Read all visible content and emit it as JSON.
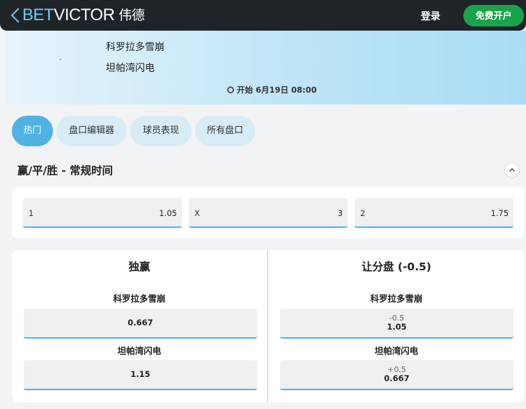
{
  "header": {
    "logo_bet": "BET",
    "logo_victor": "VICTOR",
    "logo_cn": "伟德",
    "login_label": "登录",
    "register_label": "免费开户"
  },
  "match": {
    "home_team": "科罗拉多雪崩",
    "away_team": "坦帕湾闪电",
    "separator": "-",
    "start_time": "开始 6月19日 08:00"
  },
  "tabs": [
    {
      "label": "热门",
      "active": true
    },
    {
      "label": "盘口编辑器",
      "active": false
    },
    {
      "label": "球员表现",
      "active": false
    },
    {
      "label": "所有盘口",
      "active": false
    }
  ],
  "market_1x2": {
    "title": "赢/平/胜 - 常规时间",
    "outcomes": [
      {
        "label": "1",
        "odds": "1.05"
      },
      {
        "label": "X",
        "odds": "3"
      },
      {
        "label": "2",
        "odds": "1.75"
      }
    ]
  },
  "market_win": {
    "title": "独赢",
    "rows": [
      {
        "team": "科罗拉多雪崩",
        "odds": "0.667"
      },
      {
        "team": "坦帕湾闪电",
        "odds": "1.15"
      }
    ]
  },
  "market_handicap": {
    "title": "让分盘 (-0.5)",
    "rows": [
      {
        "team": "科罗拉多雪崩",
        "line": "-0.5",
        "odds": "1.05"
      },
      {
        "team": "坦帕湾闪电",
        "line": "+0.5",
        "odds": "0.667"
      }
    ]
  },
  "colors": {
    "header_bg": "#1f2429",
    "accent_blue": "#4fb2e3",
    "register_green": "#1aa34a",
    "tab_bg": "#d8ecf7"
  },
  "icons": {
    "back": "chevron-left-icon",
    "clock": "clock-icon",
    "collapse": "chevron-up-icon"
  }
}
